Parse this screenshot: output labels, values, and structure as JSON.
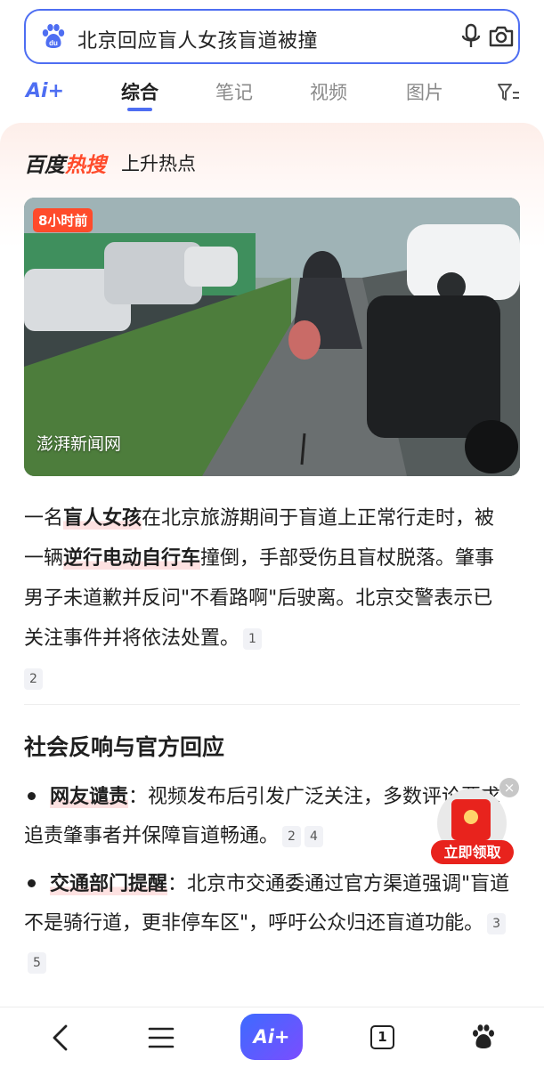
{
  "search": {
    "query": "北京回应盲人女孩盲道被撞"
  },
  "tabs": {
    "ai": "Ai+",
    "items": [
      "综合",
      "笔记",
      "视频",
      "图片"
    ]
  },
  "hot": {
    "brand_a": "百度",
    "brand_b": "热搜",
    "subtitle": "上升热点"
  },
  "video": {
    "time_badge": "8小时前",
    "source": "澎湃新闻网"
  },
  "summary": {
    "p1": "一名",
    "h1": "盲人女孩",
    "p2": "在北京旅游期间于盲道上正常行走时，被一辆",
    "h2": "逆行电动自行车",
    "p3": "撞倒，手部受伤且盲杖脱落。肇事男子未道歉并反问\"不看路啊\"后驶离。北京交警表示已关注事件并将依法处置。",
    "cite1": "1",
    "cite2": "2"
  },
  "section": {
    "title": "社会反响与官方回应",
    "bullets": [
      {
        "label": "网友谴责",
        "text": "：视频发布后引发广泛关注，多数评论要求追责肇事者并保障盲道畅通。",
        "cites": [
          "2",
          "4"
        ]
      },
      {
        "label": "交通部门提醒",
        "text": "：北京市交通委通过官方渠道强调\"盲道不是骑行道，更非停车区\"，呼吁公众归还盲道功能。",
        "cites": [
          "3",
          "5"
        ]
      }
    ]
  },
  "redpacket": {
    "label": "立即领取",
    "close": "×"
  },
  "bottom": {
    "ai": "Ai+",
    "tab_count": "1"
  },
  "colors": {
    "accent": "#4e6ef2",
    "hot_red": "#ff4b2b",
    "packet_red": "#e8231d"
  }
}
